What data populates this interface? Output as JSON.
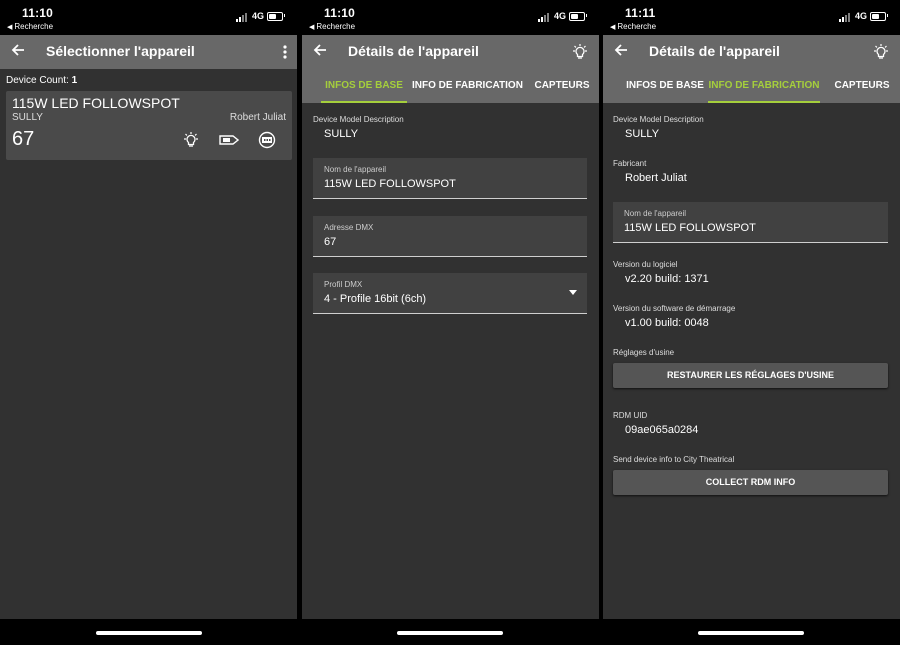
{
  "status": {
    "time_1": "11:10",
    "time_2": "11:10",
    "time_3": "11:11",
    "back_label": "Recherche",
    "network": "4G"
  },
  "colors": {
    "accent": "#a5cf3c",
    "appbar": "#686868",
    "background": "#313131",
    "card": "#4a4a4a"
  },
  "screen1": {
    "title": "Sélectionner l'appareil",
    "device_count_label": "Device Count:",
    "device_count": "1",
    "device": {
      "model": "115W LED FOLLOWSPOT",
      "description": "SULLY",
      "manufacturer": "Robert Juliat",
      "dmx_address": "67"
    },
    "icons": [
      "back-arrow-icon",
      "more-vert-icon",
      "lightbulb-icon",
      "dmx-plug-icon",
      "rdm-icon"
    ]
  },
  "tabs": {
    "basic": "INFOS DE BASE",
    "manufacturing": "INFO DE FABRICATION",
    "sensors": "CAPTEURS"
  },
  "details_title": "Détails de l'appareil",
  "screen2": {
    "model_desc_label": "Device Model Description",
    "model_desc_value": "SULLY",
    "name_label": "Nom de l'appareil",
    "name_value": "115W LED FOLLOWSPOT",
    "dmx_label": "Adresse DMX",
    "dmx_value": "67",
    "profile_label": "Profil DMX",
    "profile_value": "4 - Profile 16bit (6ch)"
  },
  "screen3": {
    "model_desc_label": "Device Model Description",
    "model_desc_value": "SULLY",
    "mfr_label": "Fabricant",
    "mfr_value": "Robert Juliat",
    "name_label": "Nom de l'appareil",
    "name_value": "115W LED FOLLOWSPOT",
    "sw_label": "Version du logiciel",
    "sw_value": "v2.20 build: 1371",
    "boot_label": "Version du software de démarrage",
    "boot_value": "v1.00 build: 0048",
    "factory_label": "Réglages d'usine",
    "factory_button": "RESTAURER LES RÉGLAGES D'USINE",
    "uid_label": "RDM UID",
    "uid_value": "09ae065a0284",
    "send_label": "Send device info to City Theatrical",
    "collect_button": "COLLECT RDM INFO"
  }
}
